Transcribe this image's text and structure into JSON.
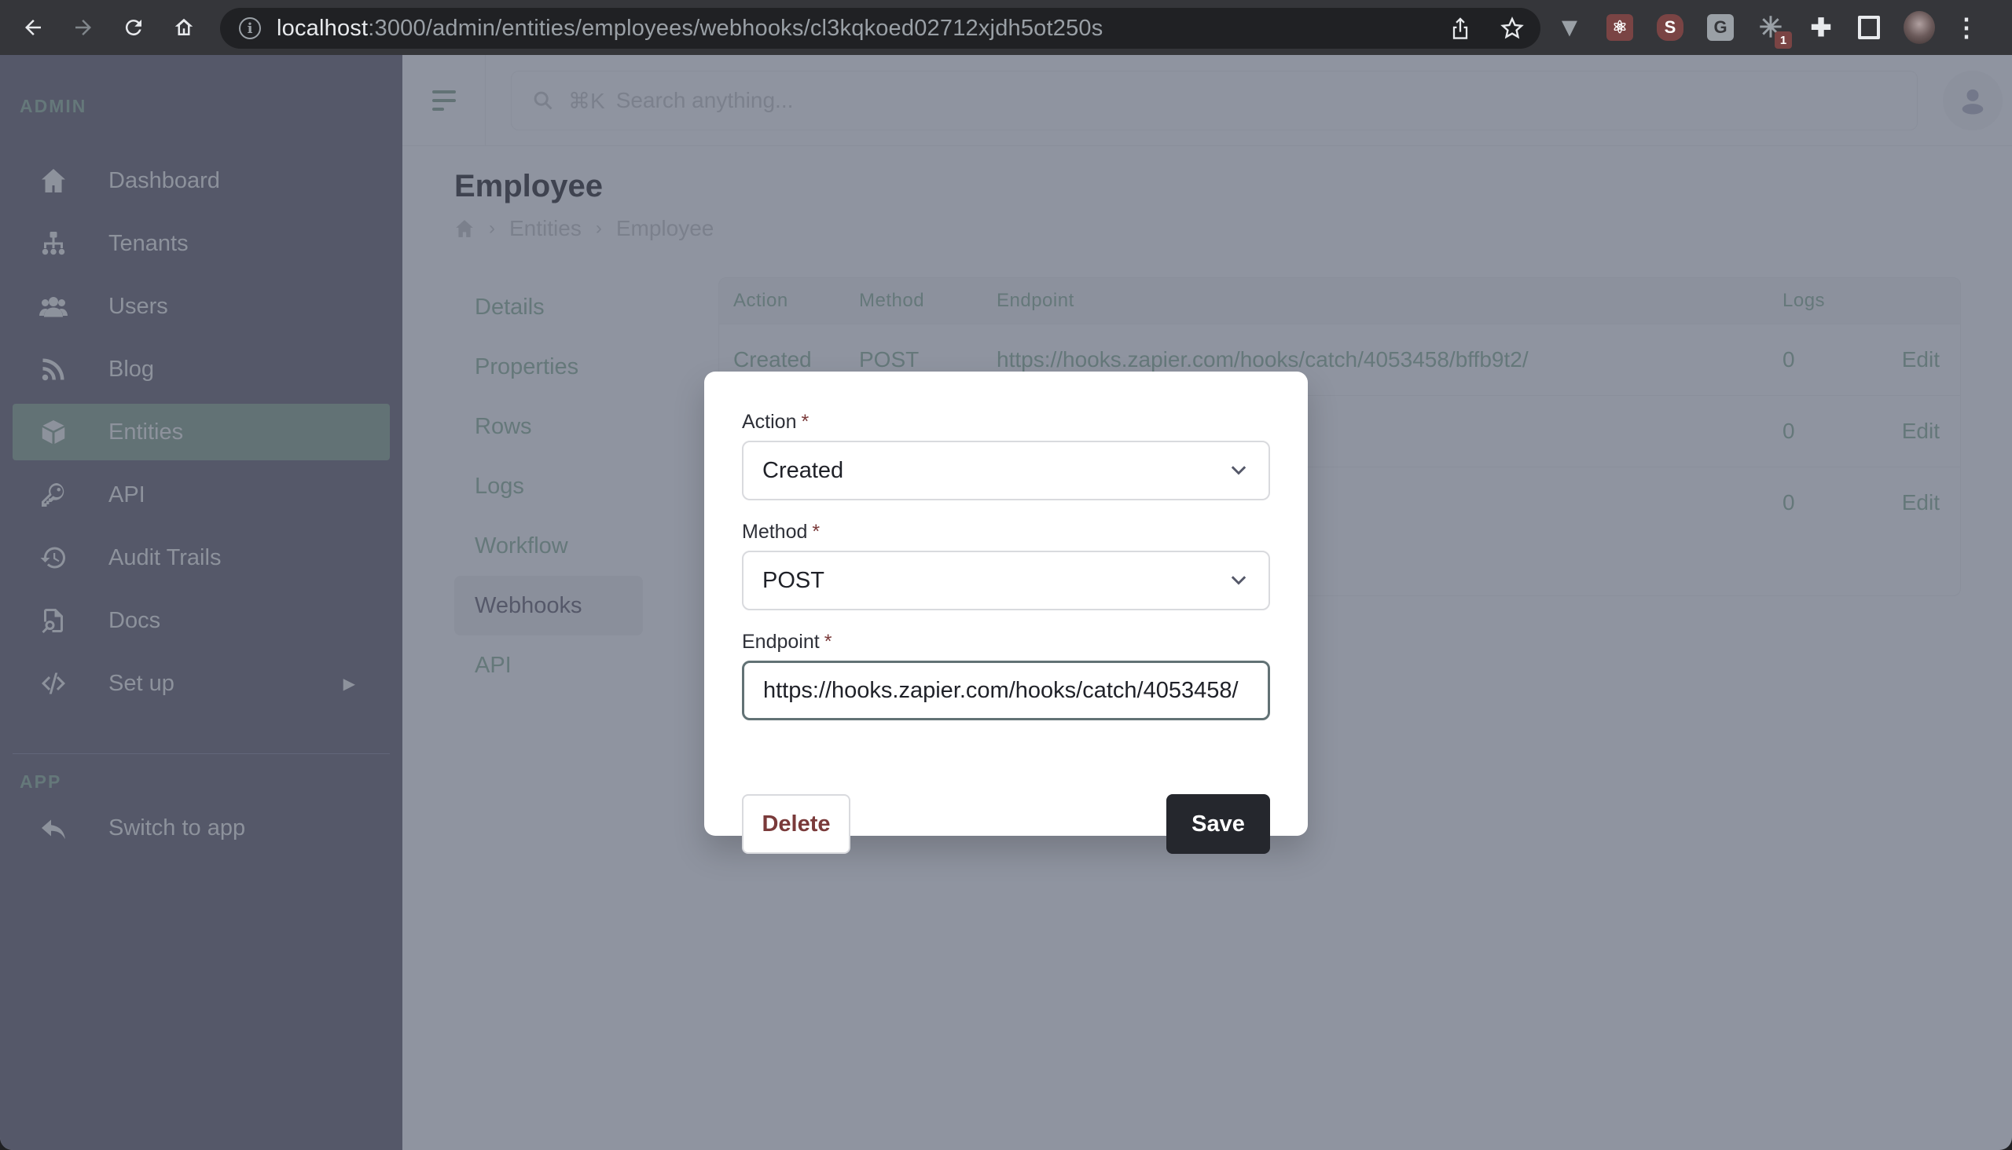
{
  "browser": {
    "url_host": "localhost",
    "url_rest": ":3000/admin/entities/employees/webhooks/cl3kqkoed02712xjdh5ot250s",
    "extension_badge": "1"
  },
  "sidebar": {
    "sections": [
      {
        "title": "ADMIN",
        "items": [
          {
            "label": "Dashboard",
            "icon": "home-icon",
            "active": false
          },
          {
            "label": "Tenants",
            "icon": "sitemap-icon",
            "active": false
          },
          {
            "label": "Users",
            "icon": "users-icon",
            "active": false
          },
          {
            "label": "Blog",
            "icon": "rss-icon",
            "active": false
          },
          {
            "label": "Entities",
            "icon": "cube-icon",
            "active": true
          },
          {
            "label": "API",
            "icon": "key-icon",
            "active": false
          },
          {
            "label": "Audit Trails",
            "icon": "history-icon",
            "active": false
          },
          {
            "label": "Docs",
            "icon": "document-search-icon",
            "active": false
          },
          {
            "label": "Set up",
            "icon": "code-icon",
            "active": false,
            "expandable": true
          }
        ]
      },
      {
        "title": "APP",
        "items": [
          {
            "label": "Switch to app",
            "icon": "reply-icon",
            "active": false
          }
        ]
      }
    ]
  },
  "header": {
    "search_shortcut": "⌘K",
    "search_placeholder": "Search anything..."
  },
  "page": {
    "title": "Employee",
    "breadcrumb": [
      "Entities",
      "Employee"
    ],
    "tabs": [
      {
        "label": "Details",
        "active": false
      },
      {
        "label": "Properties",
        "active": false
      },
      {
        "label": "Rows",
        "active": false
      },
      {
        "label": "Logs",
        "active": false
      },
      {
        "label": "Workflow",
        "active": false
      },
      {
        "label": "Webhooks",
        "active": true
      },
      {
        "label": "API",
        "active": false
      }
    ]
  },
  "table": {
    "columns": [
      "Action",
      "Method",
      "Endpoint",
      "Logs",
      ""
    ],
    "rows": [
      {
        "action": "Created",
        "method": "POST",
        "endpoint": "https://hooks.zapier.com/hooks/catch/4053458/bffb9t2/",
        "logs": "0",
        "edit": "Edit"
      },
      {
        "action": "",
        "method": "",
        "endpoint": "",
        "logs": "0",
        "edit": "Edit"
      },
      {
        "action": "",
        "method": "",
        "endpoint": "",
        "logs": "0",
        "edit": "Edit"
      }
    ]
  },
  "modal": {
    "action_label": "Action",
    "action_value": "Created",
    "method_label": "Method",
    "method_value": "POST",
    "endpoint_label": "Endpoint",
    "endpoint_value": "https://hooks.zapier.com/hooks/catch/4053458/",
    "required_marker": "*",
    "delete_label": "Delete",
    "save_label": "Save"
  },
  "colors": {
    "sidebar_bg": "#555869",
    "overlay_bg": "#8f94a0",
    "accent": "#627275",
    "danger": "#7a3a3a",
    "primary_button": "#25272d"
  }
}
